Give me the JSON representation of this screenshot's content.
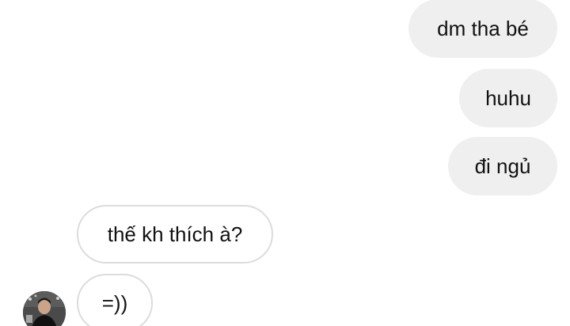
{
  "conversation": {
    "messages": [
      {
        "direction": "sent",
        "text": "dm tha bé"
      },
      {
        "direction": "sent",
        "text": "huhu"
      },
      {
        "direction": "sent",
        "text": "đi ngủ"
      },
      {
        "direction": "received",
        "text": "thế kh thích à?"
      },
      {
        "direction": "received",
        "text": "=))"
      }
    ],
    "contact_avatar_icon": "person-avatar"
  },
  "colors": {
    "sent_bubble": "#efefef",
    "received_border": "#dcdcdc",
    "text": "#111111",
    "background": "#ffffff"
  }
}
